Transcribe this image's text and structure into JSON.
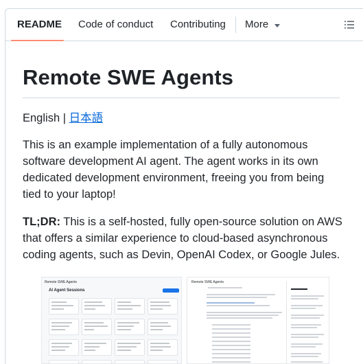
{
  "tabs": [
    {
      "label": "README",
      "active": true
    },
    {
      "label": "Code of conduct"
    },
    {
      "label": "Contributing"
    },
    {
      "label": "More"
    }
  ],
  "readme": {
    "title": "Remote SWE Agents",
    "lang_current": "English",
    "lang_separator": " | ",
    "lang_other": "日本語",
    "intro": "This is an example implementation of a fully autonomous software development AI agent. The agent works in its own dedicated development environment, freeing you from being tied to your laptop!",
    "tldr_label": "TL;DR:",
    "tldr_text": " This is a self-hosted, fully open-source solution on AWS that offers a similar experience to cloud-based asynchronous coding agents, such as Devin, OpenAI Codex, or Google Jules."
  },
  "screenshot1": {
    "app_title": "Remote SWE Agents",
    "heading": "AI Agent Sessions"
  },
  "screenshot2": {
    "app_title": "Remote SWE Agents"
  },
  "colors": {
    "accent_underline": "#fd8c73",
    "link": "#0969da",
    "button": "#1a73e8"
  }
}
